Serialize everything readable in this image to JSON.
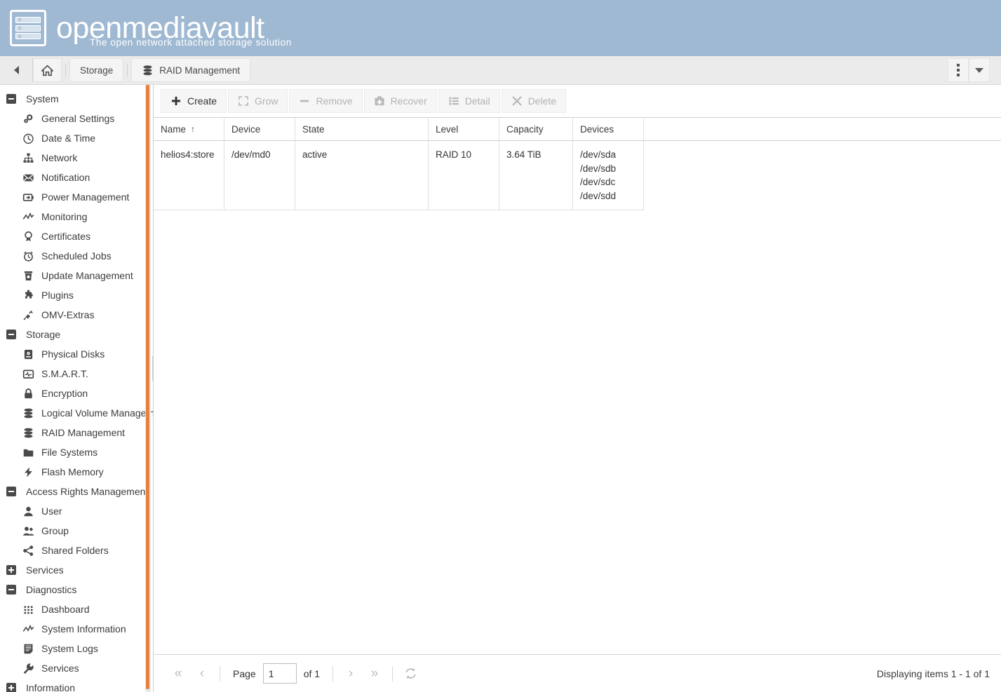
{
  "header": {
    "brand": "openmediavault",
    "tagline": "The open network attached storage solution",
    "logo_icon": "nas-server-icon"
  },
  "breadcrumb": {
    "collapse_icon": "chevron-left-icon",
    "home_icon": "home-icon",
    "items": [
      {
        "label": "Storage",
        "icon": ""
      },
      {
        "label": "RAID Management",
        "icon": "raid-disks-icon"
      }
    ],
    "overflow_icon": "kebab-menu-icon",
    "dropdown_icon": "caret-down-icon"
  },
  "toolbar": {
    "buttons": [
      {
        "label": "Create",
        "icon": "plus-icon",
        "disabled": false
      },
      {
        "label": "Grow",
        "icon": "expand-arrows-icon",
        "disabled": true
      },
      {
        "label": "Remove",
        "icon": "minus-icon",
        "disabled": true
      },
      {
        "label": "Recover",
        "icon": "first-aid-icon",
        "disabled": true
      },
      {
        "label": "Detail",
        "icon": "list-icon",
        "disabled": true
      },
      {
        "label": "Delete",
        "icon": "close-x-icon",
        "disabled": true
      }
    ]
  },
  "grid": {
    "columns": [
      {
        "label": "Name",
        "sorted": true,
        "sort_arrow": "↑"
      },
      {
        "label": "Device",
        "sorted": false,
        "sort_arrow": ""
      },
      {
        "label": "State",
        "sorted": false,
        "sort_arrow": ""
      },
      {
        "label": "Level",
        "sorted": false,
        "sort_arrow": ""
      },
      {
        "label": "Capacity",
        "sorted": false,
        "sort_arrow": ""
      },
      {
        "label": "Devices",
        "sorted": false,
        "sort_arrow": ""
      }
    ],
    "rows": [
      {
        "name": "helios4:store",
        "device": "/dev/md0",
        "state": "active",
        "level": "RAID 10",
        "capacity": "3.64 TiB",
        "devices": "/dev/sda\n/dev/sdb\n/dev/sdc\n/dev/sdd"
      }
    ]
  },
  "pager": {
    "first_icon": "«",
    "prev_icon": "‹",
    "page_label": "Page",
    "page_value": "1",
    "of_label": "of 1",
    "next_icon": "›",
    "last_icon": "»",
    "refresh_icon": "refresh-icon",
    "status": "Displaying items 1 - 1 of 1"
  },
  "sidebar": {
    "scrollbar_color": "#e8813c",
    "collapse_handle_icon": "chevron-left-icon",
    "nodes": [
      {
        "type": "group",
        "label": "System",
        "expanded": true,
        "expander_icon": "minus-box-icon"
      },
      {
        "type": "item",
        "label": "General Settings",
        "icon": "gears-icon"
      },
      {
        "type": "item",
        "label": "Date & Time",
        "icon": "clock-icon"
      },
      {
        "type": "item",
        "label": "Network",
        "icon": "network-icon"
      },
      {
        "type": "item",
        "label": "Notification",
        "icon": "envelope-icon"
      },
      {
        "type": "item",
        "label": "Power Management",
        "icon": "power-plug-icon"
      },
      {
        "type": "item",
        "label": "Monitoring",
        "icon": "chart-line-icon"
      },
      {
        "type": "item",
        "label": "Certificates",
        "icon": "award-ribbon-icon"
      },
      {
        "type": "item",
        "label": "Scheduled Jobs",
        "icon": "alarm-clock-icon"
      },
      {
        "type": "item",
        "label": "Update Management",
        "icon": "update-box-icon"
      },
      {
        "type": "item",
        "label": "Plugins",
        "icon": "puzzle-piece-icon"
      },
      {
        "type": "item",
        "label": "OMV-Extras",
        "icon": "plug-icon"
      },
      {
        "type": "group",
        "label": "Storage",
        "expanded": true,
        "expander_icon": "minus-box-icon"
      },
      {
        "type": "item",
        "label": "Physical Disks",
        "icon": "hard-disk-icon"
      },
      {
        "type": "item",
        "label": "S.M.A.R.T.",
        "icon": "monitor-pulse-icon"
      },
      {
        "type": "item",
        "label": "Encryption",
        "icon": "lock-icon"
      },
      {
        "type": "item",
        "label": "Logical Volume Managem",
        "icon": "raid-disks-icon"
      },
      {
        "type": "item",
        "label": "RAID Management",
        "icon": "raid-disks-icon"
      },
      {
        "type": "item",
        "label": "File Systems",
        "icon": "folder-icon"
      },
      {
        "type": "item",
        "label": "Flash Memory",
        "icon": "lightning-bolt-icon"
      },
      {
        "type": "group",
        "label": "Access Rights Management",
        "expanded": true,
        "expander_icon": "minus-box-icon"
      },
      {
        "type": "item",
        "label": "User",
        "icon": "user-icon"
      },
      {
        "type": "item",
        "label": "Group",
        "icon": "users-icon"
      },
      {
        "type": "item",
        "label": "Shared Folders",
        "icon": "share-nodes-icon"
      },
      {
        "type": "group",
        "label": "Services",
        "expanded": false,
        "expander_icon": "plus-box-icon"
      },
      {
        "type": "group",
        "label": "Diagnostics",
        "expanded": true,
        "expander_icon": "minus-box-icon"
      },
      {
        "type": "item",
        "label": "Dashboard",
        "icon": "grid-dots-icon"
      },
      {
        "type": "item",
        "label": "System Information",
        "icon": "chart-line-icon"
      },
      {
        "type": "item",
        "label": "System Logs",
        "icon": "document-lines-icon"
      },
      {
        "type": "item",
        "label": "Services",
        "icon": "wrench-icon"
      },
      {
        "type": "group",
        "label": "Information",
        "expanded": false,
        "expander_icon": "plus-box-icon"
      }
    ]
  }
}
